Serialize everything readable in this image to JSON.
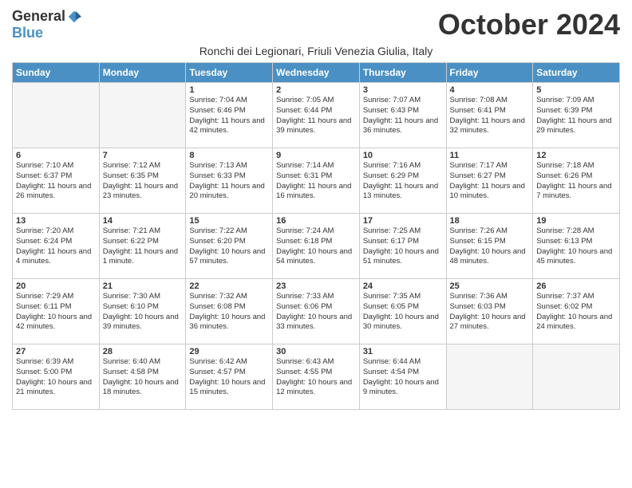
{
  "logo": {
    "general": "General",
    "blue": "Blue"
  },
  "title": "October 2024",
  "subtitle": "Ronchi dei Legionari, Friuli Venezia Giulia, Italy",
  "days_of_week": [
    "Sunday",
    "Monday",
    "Tuesday",
    "Wednesday",
    "Thursday",
    "Friday",
    "Saturday"
  ],
  "weeks": [
    [
      {
        "day": "",
        "sunrise": "",
        "sunset": "",
        "daylight": ""
      },
      {
        "day": "",
        "sunrise": "",
        "sunset": "",
        "daylight": ""
      },
      {
        "day": "1",
        "sunrise": "Sunrise: 7:04 AM",
        "sunset": "Sunset: 6:46 PM",
        "daylight": "Daylight: 11 hours and 42 minutes."
      },
      {
        "day": "2",
        "sunrise": "Sunrise: 7:05 AM",
        "sunset": "Sunset: 6:44 PM",
        "daylight": "Daylight: 11 hours and 39 minutes."
      },
      {
        "day": "3",
        "sunrise": "Sunrise: 7:07 AM",
        "sunset": "Sunset: 6:43 PM",
        "daylight": "Daylight: 11 hours and 36 minutes."
      },
      {
        "day": "4",
        "sunrise": "Sunrise: 7:08 AM",
        "sunset": "Sunset: 6:41 PM",
        "daylight": "Daylight: 11 hours and 32 minutes."
      },
      {
        "day": "5",
        "sunrise": "Sunrise: 7:09 AM",
        "sunset": "Sunset: 6:39 PM",
        "daylight": "Daylight: 11 hours and 29 minutes."
      }
    ],
    [
      {
        "day": "6",
        "sunrise": "Sunrise: 7:10 AM",
        "sunset": "Sunset: 6:37 PM",
        "daylight": "Daylight: 11 hours and 26 minutes."
      },
      {
        "day": "7",
        "sunrise": "Sunrise: 7:12 AM",
        "sunset": "Sunset: 6:35 PM",
        "daylight": "Daylight: 11 hours and 23 minutes."
      },
      {
        "day": "8",
        "sunrise": "Sunrise: 7:13 AM",
        "sunset": "Sunset: 6:33 PM",
        "daylight": "Daylight: 11 hours and 20 minutes."
      },
      {
        "day": "9",
        "sunrise": "Sunrise: 7:14 AM",
        "sunset": "Sunset: 6:31 PM",
        "daylight": "Daylight: 11 hours and 16 minutes."
      },
      {
        "day": "10",
        "sunrise": "Sunrise: 7:16 AM",
        "sunset": "Sunset: 6:29 PM",
        "daylight": "Daylight: 11 hours and 13 minutes."
      },
      {
        "day": "11",
        "sunrise": "Sunrise: 7:17 AM",
        "sunset": "Sunset: 6:27 PM",
        "daylight": "Daylight: 11 hours and 10 minutes."
      },
      {
        "day": "12",
        "sunrise": "Sunrise: 7:18 AM",
        "sunset": "Sunset: 6:26 PM",
        "daylight": "Daylight: 11 hours and 7 minutes."
      }
    ],
    [
      {
        "day": "13",
        "sunrise": "Sunrise: 7:20 AM",
        "sunset": "Sunset: 6:24 PM",
        "daylight": "Daylight: 11 hours and 4 minutes."
      },
      {
        "day": "14",
        "sunrise": "Sunrise: 7:21 AM",
        "sunset": "Sunset: 6:22 PM",
        "daylight": "Daylight: 11 hours and 1 minute."
      },
      {
        "day": "15",
        "sunrise": "Sunrise: 7:22 AM",
        "sunset": "Sunset: 6:20 PM",
        "daylight": "Daylight: 10 hours and 57 minutes."
      },
      {
        "day": "16",
        "sunrise": "Sunrise: 7:24 AM",
        "sunset": "Sunset: 6:18 PM",
        "daylight": "Daylight: 10 hours and 54 minutes."
      },
      {
        "day": "17",
        "sunrise": "Sunrise: 7:25 AM",
        "sunset": "Sunset: 6:17 PM",
        "daylight": "Daylight: 10 hours and 51 minutes."
      },
      {
        "day": "18",
        "sunrise": "Sunrise: 7:26 AM",
        "sunset": "Sunset: 6:15 PM",
        "daylight": "Daylight: 10 hours and 48 minutes."
      },
      {
        "day": "19",
        "sunrise": "Sunrise: 7:28 AM",
        "sunset": "Sunset: 6:13 PM",
        "daylight": "Daylight: 10 hours and 45 minutes."
      }
    ],
    [
      {
        "day": "20",
        "sunrise": "Sunrise: 7:29 AM",
        "sunset": "Sunset: 6:11 PM",
        "daylight": "Daylight: 10 hours and 42 minutes."
      },
      {
        "day": "21",
        "sunrise": "Sunrise: 7:30 AM",
        "sunset": "Sunset: 6:10 PM",
        "daylight": "Daylight: 10 hours and 39 minutes."
      },
      {
        "day": "22",
        "sunrise": "Sunrise: 7:32 AM",
        "sunset": "Sunset: 6:08 PM",
        "daylight": "Daylight: 10 hours and 36 minutes."
      },
      {
        "day": "23",
        "sunrise": "Sunrise: 7:33 AM",
        "sunset": "Sunset: 6:06 PM",
        "daylight": "Daylight: 10 hours and 33 minutes."
      },
      {
        "day": "24",
        "sunrise": "Sunrise: 7:35 AM",
        "sunset": "Sunset: 6:05 PM",
        "daylight": "Daylight: 10 hours and 30 minutes."
      },
      {
        "day": "25",
        "sunrise": "Sunrise: 7:36 AM",
        "sunset": "Sunset: 6:03 PM",
        "daylight": "Daylight: 10 hours and 27 minutes."
      },
      {
        "day": "26",
        "sunrise": "Sunrise: 7:37 AM",
        "sunset": "Sunset: 6:02 PM",
        "daylight": "Daylight: 10 hours and 24 minutes."
      }
    ],
    [
      {
        "day": "27",
        "sunrise": "Sunrise: 6:39 AM",
        "sunset": "Sunset: 5:00 PM",
        "daylight": "Daylight: 10 hours and 21 minutes."
      },
      {
        "day": "28",
        "sunrise": "Sunrise: 6:40 AM",
        "sunset": "Sunset: 4:58 PM",
        "daylight": "Daylight: 10 hours and 18 minutes."
      },
      {
        "day": "29",
        "sunrise": "Sunrise: 6:42 AM",
        "sunset": "Sunset: 4:57 PM",
        "daylight": "Daylight: 10 hours and 15 minutes."
      },
      {
        "day": "30",
        "sunrise": "Sunrise: 6:43 AM",
        "sunset": "Sunset: 4:55 PM",
        "daylight": "Daylight: 10 hours and 12 minutes."
      },
      {
        "day": "31",
        "sunrise": "Sunrise: 6:44 AM",
        "sunset": "Sunset: 4:54 PM",
        "daylight": "Daylight: 10 hours and 9 minutes."
      },
      {
        "day": "",
        "sunrise": "",
        "sunset": "",
        "daylight": ""
      },
      {
        "day": "",
        "sunrise": "",
        "sunset": "",
        "daylight": ""
      }
    ]
  ]
}
